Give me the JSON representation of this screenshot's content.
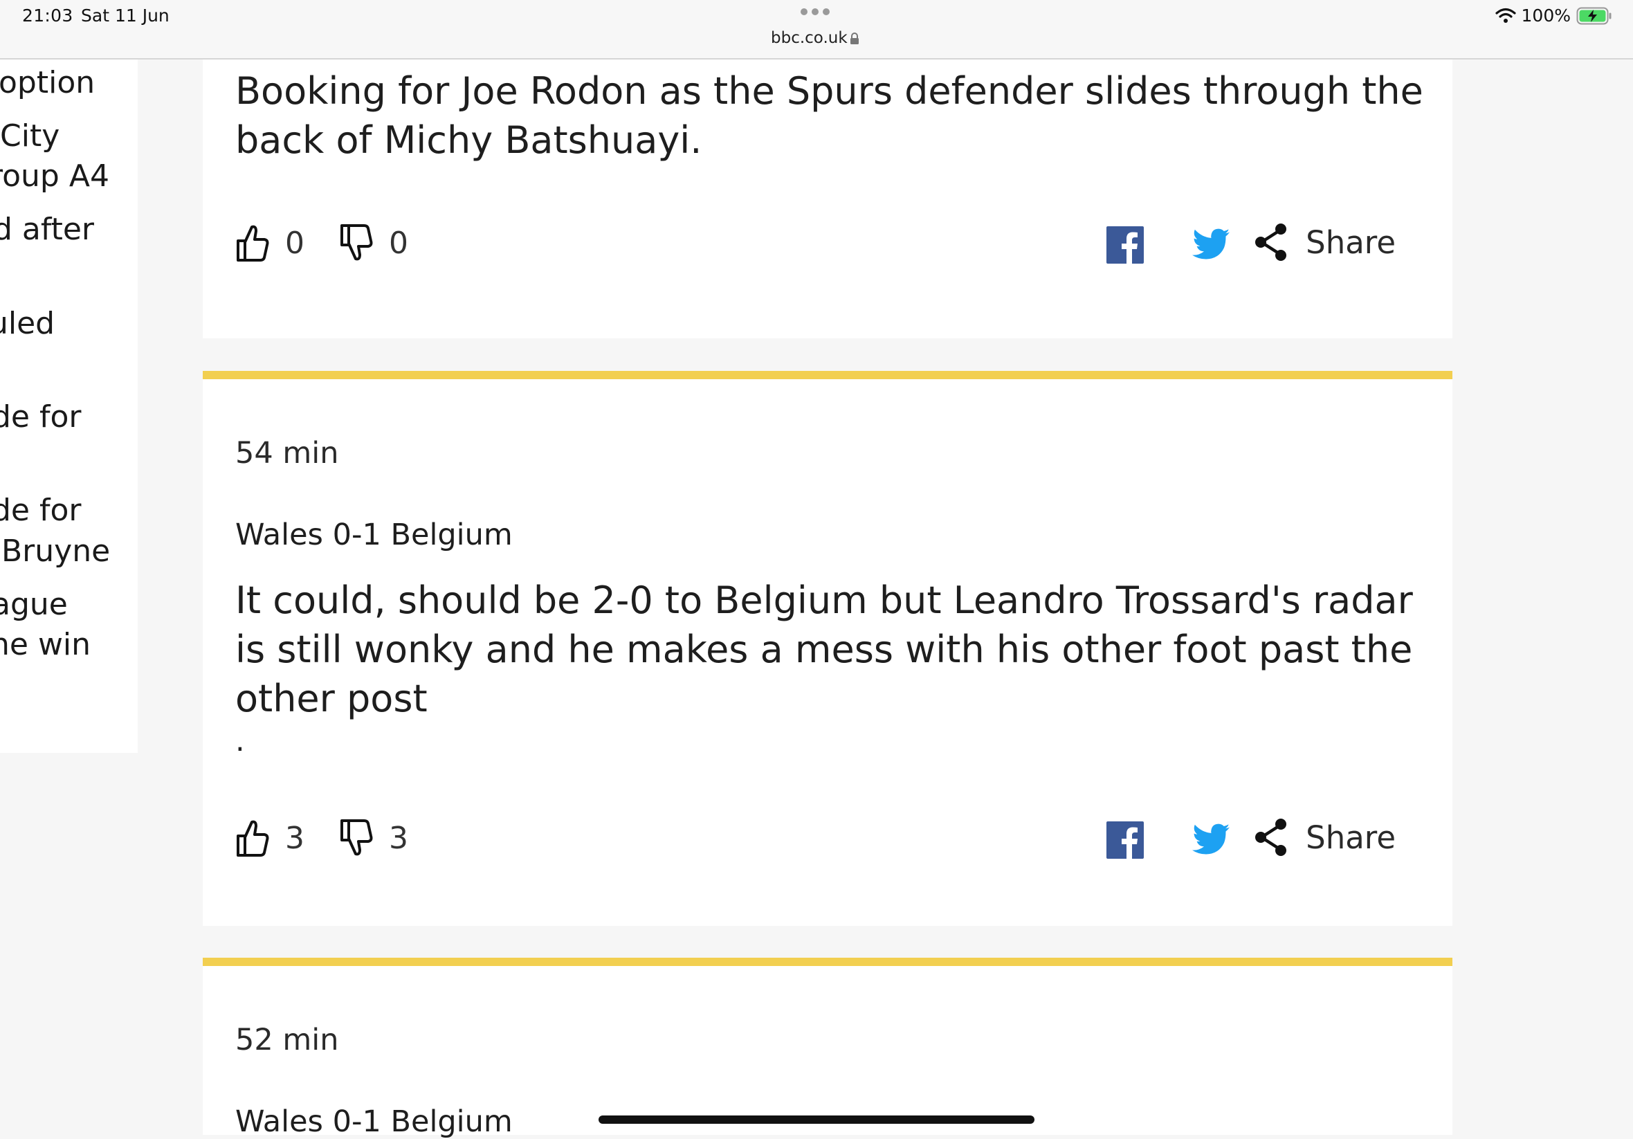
{
  "status_bar": {
    "time": "21:03",
    "date": "Sat 11 Jun",
    "url": "bbc.co.uk",
    "battery": "100%"
  },
  "sidebar": {
    "lines": [
      "option",
      "City",
      "roup A4",
      "d after",
      "uled",
      "de for",
      "de for",
      "Bruyne",
      "ague",
      "ne win"
    ]
  },
  "entries": [
    {
      "text": "Booking for Joe Rodon as the Spurs defender slides through the back of Michy Batshuayi.",
      "likes": "0",
      "dislikes": "0",
      "share_label": "Share"
    },
    {
      "time": "54 min",
      "score": "Wales 0-1 Belgium",
      "text": "It could, should be 2-0 to Belgium but Leandro Trossard's radar is still wonky and he makes a mess with his other foot past the other post",
      "trailing": ".",
      "likes": "3",
      "dislikes": "3",
      "share_label": "Share"
    },
    {
      "time": "52 min",
      "score": "Wales 0-1 Belgium"
    }
  ],
  "colors": {
    "accent": "#f2cf50",
    "facebook": "#3b5998",
    "twitter": "#1da1f2",
    "battery": "#4cd964"
  }
}
